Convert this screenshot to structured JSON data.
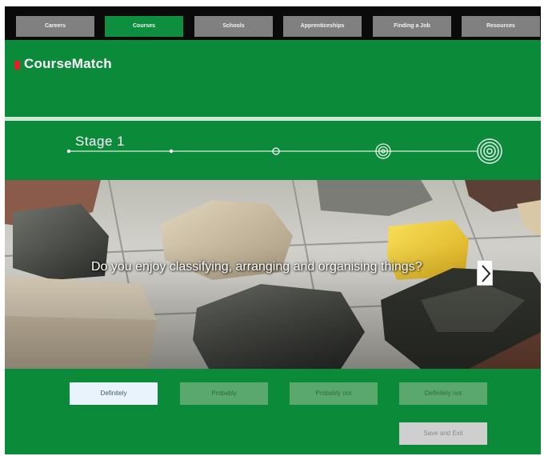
{
  "nav": {
    "items": [
      {
        "label": "Careers",
        "active": false
      },
      {
        "label": "Courses",
        "active": true
      },
      {
        "label": "Schools",
        "active": false
      },
      {
        "label": "Apprenticeships",
        "active": false
      },
      {
        "label": "Finding a Job",
        "active": false
      },
      {
        "label": "Resources",
        "active": false
      }
    ]
  },
  "header": {
    "app_name": "CourseMatch"
  },
  "progress": {
    "stage_label": "Stage 1",
    "current_stage": 1,
    "total_steps": 5
  },
  "question": {
    "text": "Do you enjoy classifying, arranging and organising things?",
    "next_icon": "chevron-right-icon"
  },
  "answers": {
    "options": [
      "Definitely",
      "Probably",
      "Probably not",
      "Definitely not"
    ],
    "selected": "Definitely",
    "save_label": "Save and Exit"
  },
  "colors": {
    "brand_green": "#0b8a3a",
    "nav_background": "#0a0a0a",
    "nav_button": "#808080",
    "logo_accent": "#e4202a",
    "answer_button": "#5aa86d",
    "selected_answer": "#e9f3fb"
  }
}
